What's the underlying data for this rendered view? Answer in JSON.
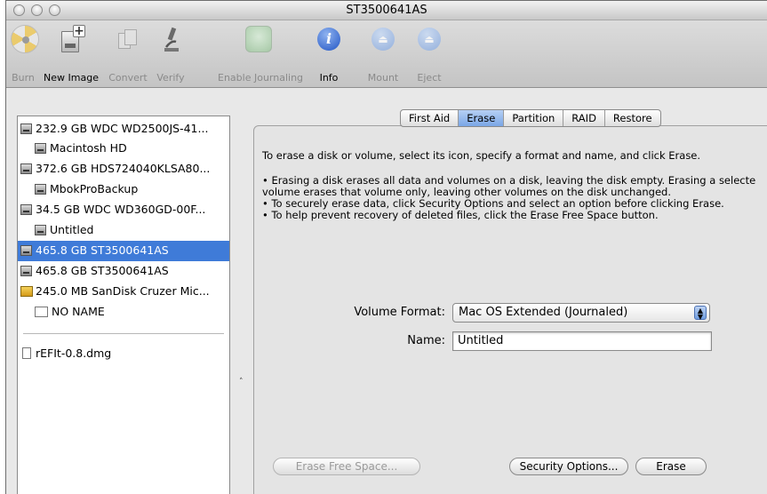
{
  "window": {
    "title": "ST3500641AS"
  },
  "toolbar": {
    "items": [
      {
        "label": "Burn",
        "icon": "burn-icon",
        "enabled": false
      },
      {
        "label": "New Image",
        "icon": "new-image-icon",
        "enabled": true
      },
      {
        "label": "Convert",
        "icon": "convert-icon",
        "enabled": false
      },
      {
        "label": "Verify",
        "icon": "microscope-icon",
        "enabled": false
      },
      {
        "label": "Enable Journaling",
        "icon": "journal-icon",
        "enabled": false
      },
      {
        "label": "Info",
        "icon": "info-icon",
        "enabled": true
      },
      {
        "label": "Mount",
        "icon": "mount-icon",
        "enabled": false
      },
      {
        "label": "Eject",
        "icon": "eject-icon",
        "enabled": false
      }
    ]
  },
  "sidebar": {
    "items": [
      {
        "label": "232.9 GB WDC WD2500JS-41...",
        "type": "disk",
        "selected": false
      },
      {
        "label": "Macintosh HD",
        "type": "volume",
        "selected": false
      },
      {
        "label": "372.6 GB HDS724040KLSA80...",
        "type": "disk",
        "selected": false
      },
      {
        "label": "MbokProBackup",
        "type": "volume",
        "selected": false
      },
      {
        "label": "34.5 GB WDC WD360GD-00F...",
        "type": "disk",
        "selected": false
      },
      {
        "label": "Untitled",
        "type": "volume",
        "selected": false
      },
      {
        "label": "465.8 GB ST3500641AS",
        "type": "disk",
        "selected": true
      },
      {
        "label": "465.8 GB ST3500641AS",
        "type": "disk",
        "selected": false
      },
      {
        "label": "245.0 MB SanDisk Cruzer Mic...",
        "type": "usb",
        "selected": false
      },
      {
        "label": "NO NAME",
        "type": "blank-volume",
        "selected": false
      }
    ],
    "images": [
      {
        "label": "rEFIt-0.8.dmg",
        "type": "image-file"
      }
    ]
  },
  "tabs": {
    "items": [
      "First Aid",
      "Erase",
      "Partition",
      "RAID",
      "Restore"
    ],
    "active": "Erase"
  },
  "erase": {
    "intro": "To erase a disk or volume, select its icon, specify a format and name, and click Erase.",
    "bullet1_line1": "• Erasing a disk erases all data and volumes on a disk, leaving the disk empty. Erasing a selecte",
    "bullet1_line2": "volume erases that volume only, leaving other volumes on the disk unchanged.",
    "bullet2": "• To securely erase data, click Security Options and select an option before clicking Erase.",
    "bullet3": "• To help prevent recovery of deleted files, click the Erase Free Space button.",
    "format_label": "Volume Format:",
    "format_value": "Mac OS Extended (Journaled)",
    "name_label": "Name:",
    "name_value": "Untitled",
    "free_space_button": "Erase Free Space...",
    "security_button": "Security Options...",
    "erase_button": "Erase"
  },
  "splitter": {
    "glyph": "˄"
  }
}
